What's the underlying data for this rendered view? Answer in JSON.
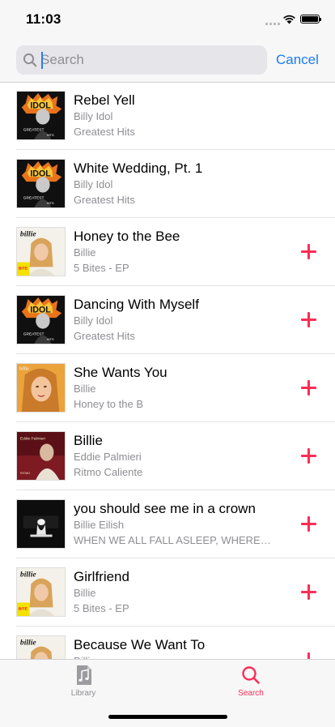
{
  "status_bar": {
    "time": "11:03"
  },
  "search": {
    "placeholder": "Search",
    "value": "",
    "cancel_label": "Cancel"
  },
  "results": [
    {
      "title": "Rebel Yell",
      "artist": "Billy Idol",
      "album": "Greatest Hits",
      "artwork": "idol-greatest-hits-art",
      "show_add": false
    },
    {
      "title": "White Wedding, Pt. 1",
      "artist": "Billy Idol",
      "album": "Greatest Hits",
      "artwork": "idol-greatest-hits-art",
      "show_add": false
    },
    {
      "title": "Honey to the Bee",
      "artist": "Billie",
      "album": "5 Bites - EP",
      "artwork": "billie-5-bites-art",
      "show_add": true
    },
    {
      "title": "Dancing With Myself",
      "artist": "Billy Idol",
      "album": "Greatest Hits",
      "artwork": "idol-greatest-hits-art",
      "show_add": true
    },
    {
      "title": "She Wants You",
      "artist": "Billie",
      "album": "Honey to the B",
      "artwork": "billie-honey-art",
      "show_add": true
    },
    {
      "title": "Billie",
      "artist": "Eddie Palmieri",
      "album": "Ritmo Caliente",
      "artwork": "palmieri-ritmo-art",
      "show_add": true
    },
    {
      "title": "you should see me in a crown",
      "artist": "Billie Eilish",
      "album": "WHEN WE ALL FALL ASLEEP, WHERE DO WE GO?",
      "artwork": "eilish-wwafawdwg-art",
      "show_add": true
    },
    {
      "title": "Girlfriend",
      "artist": "Billie",
      "album": "5 Bites - EP",
      "artwork": "billie-5-bites-art",
      "show_add": true
    },
    {
      "title": "Because We Want To",
      "artist": "Billie",
      "album": "",
      "artwork": "billie-5-bites-art",
      "show_add": true
    }
  ],
  "tab_bar": {
    "tabs": [
      {
        "label": "Library",
        "icon": "music-note-icon",
        "active": false
      },
      {
        "label": "Search",
        "icon": "search-icon",
        "active": true
      }
    ]
  },
  "colors": {
    "accent": "#fa2d55",
    "link": "#1b7cf2",
    "secondary_text": "#8e8e93"
  }
}
